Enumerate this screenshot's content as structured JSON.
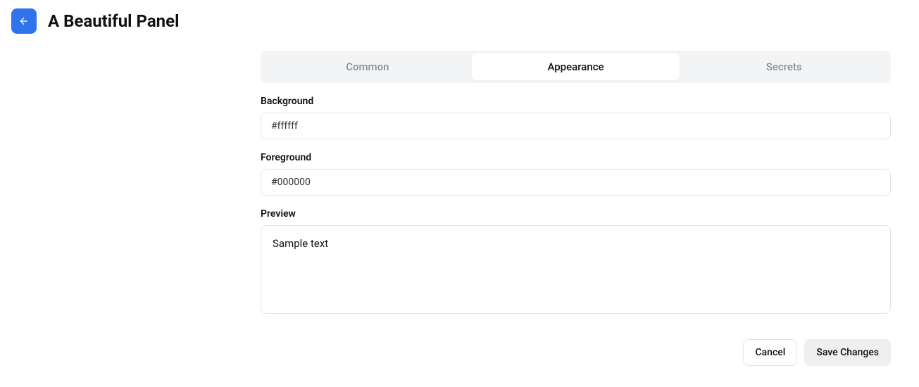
{
  "header": {
    "title": "A Beautiful Panel"
  },
  "tabs": {
    "items": [
      {
        "label": "Common"
      },
      {
        "label": "Appearance"
      },
      {
        "label": "Secrets"
      }
    ],
    "active_index": 1
  },
  "form": {
    "background": {
      "label": "Background",
      "value": "#ffffff"
    },
    "foreground": {
      "label": "Foreground",
      "value": "#000000"
    },
    "preview": {
      "label": "Preview",
      "sample_text": "Sample text"
    }
  },
  "buttons": {
    "cancel": "Cancel",
    "save": "Save Changes"
  }
}
